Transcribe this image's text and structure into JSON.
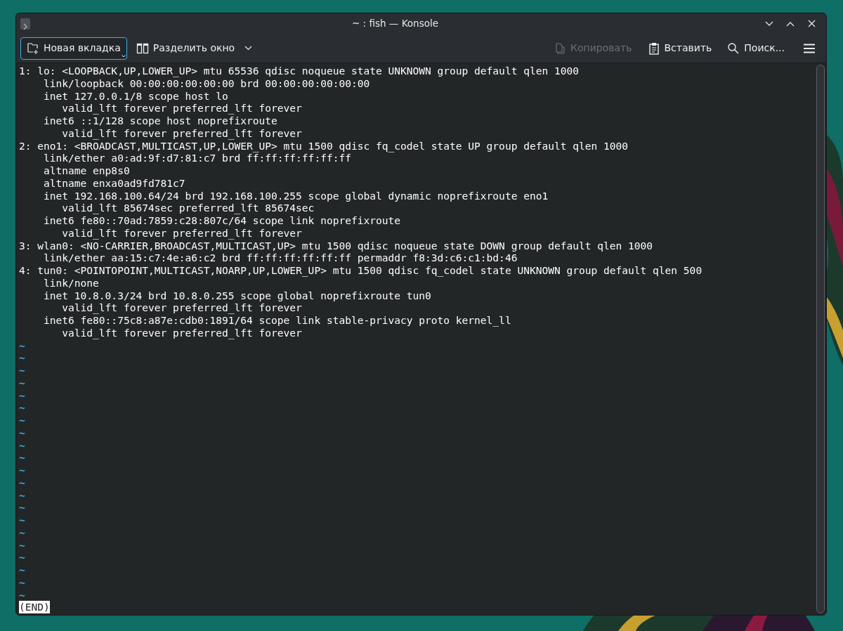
{
  "window": {
    "title": "~ : fish — Konsole"
  },
  "toolbar": {
    "buttons": [
      {
        "kind": "new-tab",
        "label": "Новая вкладка",
        "focused": true,
        "disabled": false
      },
      {
        "kind": "split",
        "label": "Разделить окно",
        "focused": false,
        "disabled": false
      },
      {
        "kind": "copy",
        "label": "Копировать",
        "focused": false,
        "disabled": true
      },
      {
        "kind": "paste",
        "label": "Вставить",
        "focused": false,
        "disabled": false
      },
      {
        "kind": "search",
        "label": "Поиск...",
        "focused": false,
        "disabled": false
      }
    ]
  },
  "terminal": {
    "lines": [
      {
        "kind": "output",
        "text": "1: lo: <LOOPBACK,UP,LOWER_UP> mtu 65536 qdisc noqueue state UNKNOWN group default qlen 1000"
      },
      {
        "kind": "output",
        "text": "    link/loopback 00:00:00:00:00:00 brd 00:00:00:00:00:00"
      },
      {
        "kind": "output",
        "text": "    inet 127.0.0.1/8 scope host lo"
      },
      {
        "kind": "output",
        "text": "       valid_lft forever preferred_lft forever"
      },
      {
        "kind": "output",
        "text": "    inet6 ::1/128 scope host noprefixroute"
      },
      {
        "kind": "output",
        "text": "       valid_lft forever preferred_lft forever"
      },
      {
        "kind": "output",
        "text": "2: eno1: <BROADCAST,MULTICAST,UP,LOWER_UP> mtu 1500 qdisc fq_codel state UP group default qlen 1000"
      },
      {
        "kind": "output",
        "text": "    link/ether a0:ad:9f:d7:81:c7 brd ff:ff:ff:ff:ff:ff"
      },
      {
        "kind": "output",
        "text": "    altname enp8s0"
      },
      {
        "kind": "output",
        "text": "    altname enxa0ad9fd781c7"
      },
      {
        "kind": "output",
        "text": "    inet 192.168.100.64/24 brd 192.168.100.255 scope global dynamic noprefixroute eno1"
      },
      {
        "kind": "output",
        "text": "       valid_lft 85674sec preferred_lft 85674sec"
      },
      {
        "kind": "output",
        "text": "    inet6 fe80::70ad:7859:c28:807c/64 scope link noprefixroute"
      },
      {
        "kind": "output",
        "text": "       valid_lft forever preferred_lft forever"
      },
      {
        "kind": "output",
        "text": "3: wlan0: <NO-CARRIER,BROADCAST,MULTICAST,UP> mtu 1500 qdisc noqueue state DOWN group default qlen 1000"
      },
      {
        "kind": "output",
        "text": "    link/ether aa:15:c7:4e:a6:c2 brd ff:ff:ff:ff:ff:ff permaddr f8:3d:c6:c1:bd:46"
      },
      {
        "kind": "output",
        "text": "4: tun0: <POINTOPOINT,MULTICAST,NOARP,UP,LOWER_UP> mtu 1500 qdisc fq_codel state UNKNOWN group default qlen 500"
      },
      {
        "kind": "output",
        "text": "    link/none"
      },
      {
        "kind": "output",
        "text": "    inet 10.8.0.3/24 brd 10.8.0.255 scope global noprefixroute tun0"
      },
      {
        "kind": "output",
        "text": "       valid_lft forever preferred_lft forever"
      },
      {
        "kind": "output",
        "text": "    inet6 fe80::75c8:a87e:cdb0:1891/64 scope link stable-privacy proto kernel_ll"
      },
      {
        "kind": "output",
        "text": "       valid_lft forever preferred_lft forever"
      },
      {
        "kind": "filler",
        "text": "~"
      },
      {
        "kind": "filler",
        "text": "~"
      },
      {
        "kind": "filler",
        "text": "~"
      },
      {
        "kind": "filler",
        "text": "~"
      },
      {
        "kind": "filler",
        "text": "~"
      },
      {
        "kind": "filler",
        "text": "~"
      },
      {
        "kind": "filler",
        "text": "~"
      },
      {
        "kind": "filler",
        "text": "~"
      },
      {
        "kind": "filler",
        "text": "~"
      },
      {
        "kind": "filler",
        "text": "~"
      },
      {
        "kind": "filler",
        "text": "~"
      },
      {
        "kind": "filler",
        "text": "~"
      },
      {
        "kind": "filler",
        "text": "~"
      },
      {
        "kind": "filler",
        "text": "~"
      },
      {
        "kind": "filler",
        "text": "~"
      },
      {
        "kind": "filler",
        "text": "~"
      },
      {
        "kind": "filler",
        "text": "~"
      },
      {
        "kind": "filler",
        "text": "~"
      },
      {
        "kind": "filler",
        "text": "~"
      },
      {
        "kind": "filler",
        "text": "~"
      },
      {
        "kind": "filler",
        "text": "~"
      },
      {
        "kind": "status",
        "text": "(END)"
      }
    ]
  }
}
